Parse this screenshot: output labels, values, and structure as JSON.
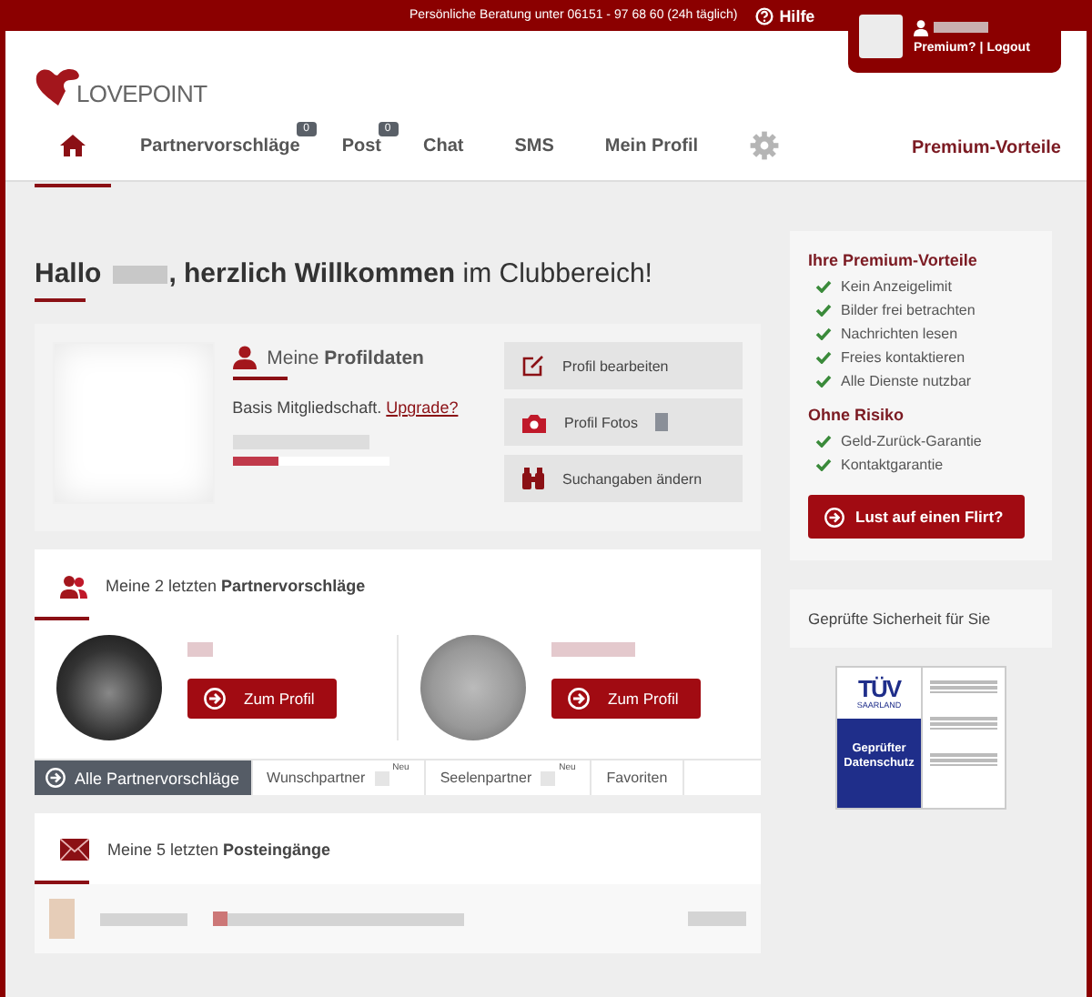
{
  "top_bar": {
    "hotline": "Persönliche Beratung unter 06151 - 97 68 60 (24h täglich)",
    "help": "Hilfe"
  },
  "account": {
    "premium_link": "Premium?",
    "separator": "|",
    "logout_link": "Logout"
  },
  "logo": "LOVEPOINT",
  "nav": [
    {
      "kind": "home",
      "selected": true
    },
    {
      "kind": "link",
      "label": "Partnervorschläge",
      "badge": "0",
      "selected": false
    },
    {
      "kind": "link",
      "label": "Post",
      "badge": "0",
      "selected": false
    },
    {
      "kind": "link",
      "label": "Chat",
      "selected": false
    },
    {
      "kind": "link",
      "label": "SMS",
      "selected": false
    },
    {
      "kind": "link",
      "label": "Mein Profil",
      "selected": false
    },
    {
      "kind": "settings",
      "selected": false
    }
  ],
  "premium_nav": "Premium-Vorteile",
  "greeting": {
    "hello": "Hallo",
    "rest": "**, herzlich Willkommen** im Clubbereich!"
  },
  "profile": {
    "title": "Meine **Profildaten**",
    "completion": {
      "level": 0.3
    },
    "membership": "Basis Mitgliedschaft.",
    "upgrade": "Upgrade?",
    "actions": [
      {
        "kind": "edit",
        "label": "Profil bearbeiten"
      },
      {
        "kind": "camera",
        "label": "Profil Fotos"
      },
      {
        "kind": "binoculars",
        "label": "Suchangaben ändern"
      }
    ]
  },
  "partners": {
    "title": "Meine 2 letzten **Partnervorschläge**",
    "items": [
      {
        "button": "Zum Profil"
      },
      {
        "button": "Zum Profil"
      }
    ],
    "tabs": [
      {
        "label": "Alle Partnervorschläge",
        "selected": true
      },
      {
        "label": "Wunschpartner",
        "badge": "Neu",
        "selected": false
      },
      {
        "label": "Seelenpartner",
        "badge": "Neu",
        "selected": false
      },
      {
        "label": "Favoriten",
        "selected": false
      }
    ]
  },
  "mail": {
    "title": "Meine 5 letzten **Posteingänge**"
  },
  "premium_box": {
    "title": "Ihre Premium-Vorteile",
    "benefits": [
      "Kein Anzeigelimit",
      "Bilder frei betrachten",
      "Nachrichten lesen",
      "Freies kontaktieren",
      "Alle Dienste nutzbar"
    ],
    "risk_title": "Ohne Risiko",
    "guarantees": [
      "Geld-Zurück-Garantie",
      "Kontaktgarantie"
    ],
    "button": "Lust auf einen Flirt?"
  },
  "security": {
    "title": "Geprüfte Sicherheit für Sie",
    "seal_brand": "TÜV",
    "seal_region": "SAARLAND",
    "seal_label": "Geprüfter Datenschutz"
  }
}
